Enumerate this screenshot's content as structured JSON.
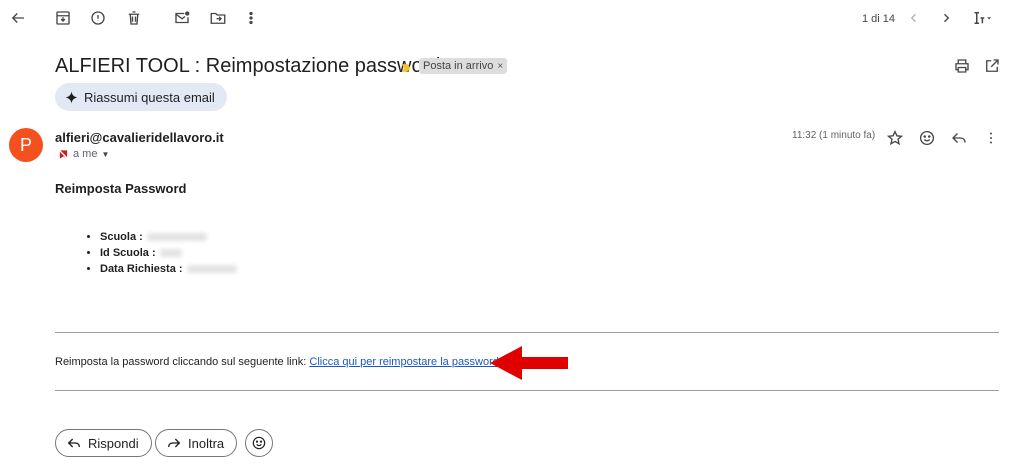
{
  "toolbar": {
    "counter": "1 di 14"
  },
  "message": {
    "subject": "ALFIERI TOOL : Reimpostazione password",
    "label": "Posta in arrivo",
    "summarize_label": "Riassumi questa email",
    "avatar_letter": "P",
    "sender": "alfieri@cavalieridellavoro.it",
    "recipient": "a me",
    "timestamp": "11:32 (1 minuto fa)"
  },
  "body": {
    "title": "Reimposta Password",
    "fields": [
      {
        "label": "Scuola :"
      },
      {
        "label": "Id Scuola :"
      },
      {
        "label": "Data Richiesta :"
      }
    ],
    "link_prefix": "Reimposta la password cliccando sul seguente link:",
    "link_text": "Clicca qui per reimpostare la password"
  },
  "actions": {
    "reply_label": "Rispondi",
    "forward_label": "Inoltra"
  },
  "colors": {
    "avatar": "#f4511e",
    "arrow": "#e00000",
    "link": "#1a57c9",
    "important_marker": "#f6c026"
  }
}
